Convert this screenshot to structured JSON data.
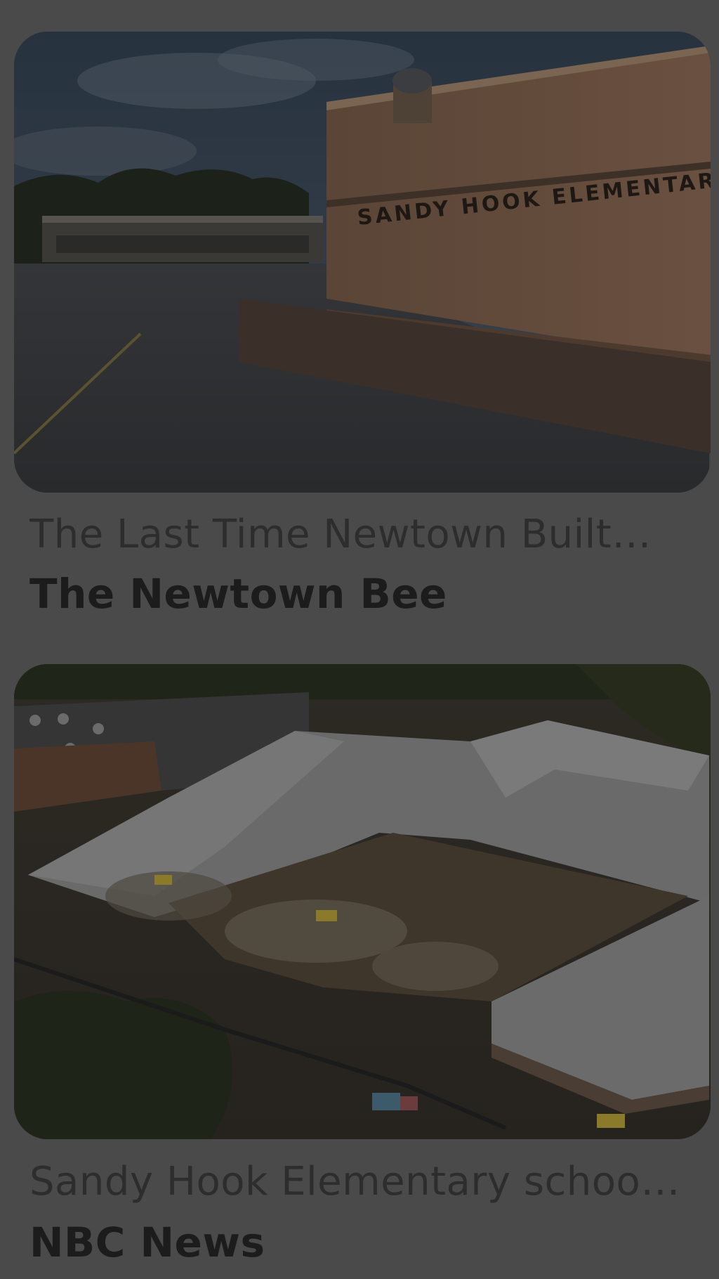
{
  "feed": {
    "items": [
      {
        "headline": "The Last Time Newtown Built…",
        "source": "The Newtown Bee",
        "image_alt": "Sandy Hook Elementary brick building"
      },
      {
        "headline": "Sandy Hook Elementary schoo…",
        "source": "NBC News",
        "image_alt": "Aerial view of school demolition"
      }
    ]
  },
  "colors": {
    "background": "#4a4a4a",
    "headline": "#2d2d2d",
    "source": "#1c1c1c"
  },
  "sign_text": "SANDY HOOK ELEMENTARY"
}
